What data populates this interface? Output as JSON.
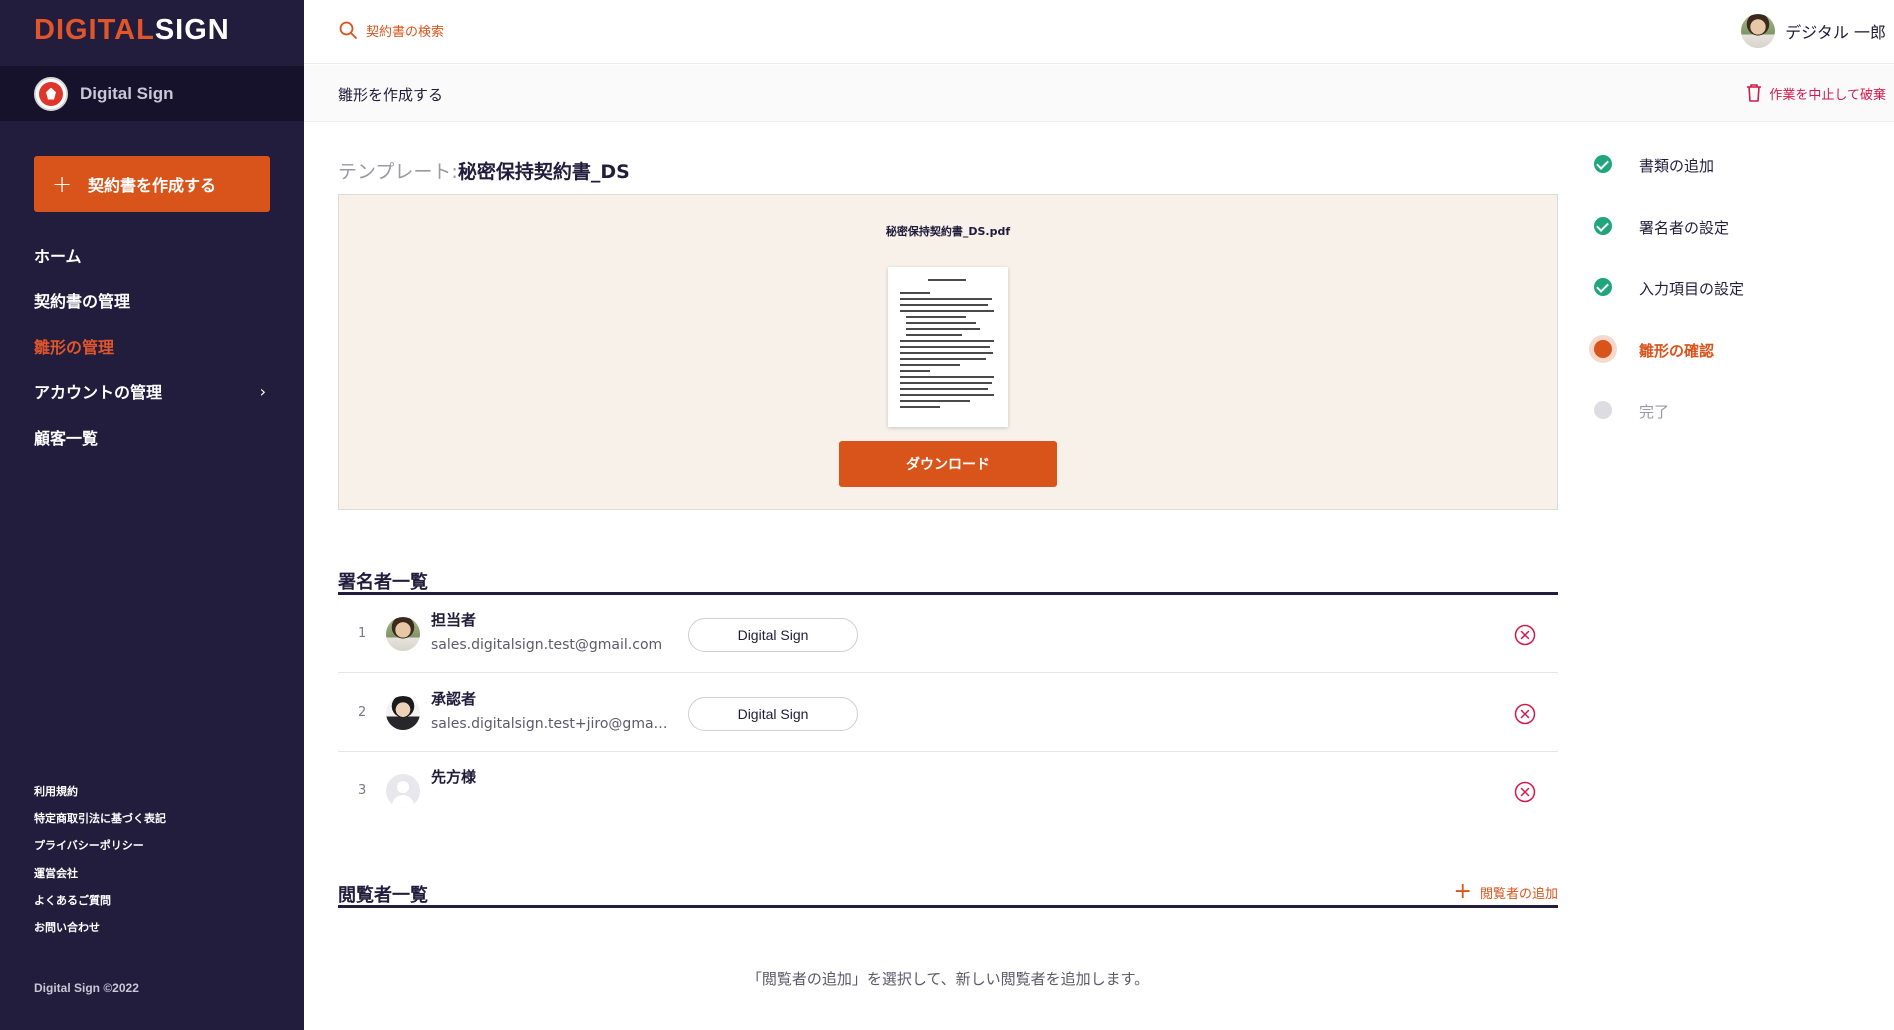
{
  "brand": {
    "logo_part1": "DIGITAL",
    "logo_part2": "SIGN",
    "org_name": "Digital Sign",
    "copyright": "Digital Sign ©2022"
  },
  "sidebar": {
    "create_label": "契約書を作成する",
    "items": [
      {
        "label": "ホーム"
      },
      {
        "label": "契約書の管理"
      },
      {
        "label": "雛形の管理"
      },
      {
        "label": "アカウントの管理",
        "chevron": "›"
      },
      {
        "label": "顧客一覧"
      }
    ],
    "footer_links": [
      "利用規約",
      "特定商取引法に基づく表記",
      "プライバシーポリシー",
      "運営会社",
      "よくあるご質問",
      "お問い合わせ"
    ]
  },
  "header": {
    "search_placeholder": "契約書の検索",
    "user_name": "デジタル 一郎"
  },
  "subheader": {
    "title": "雛形を作成する",
    "discard_label": "作業を中止して破棄"
  },
  "template": {
    "label": "テンプレート:",
    "name": "秘密保持契約書_DS",
    "file_name": "秘密保持契約書_DS.pdf",
    "download_label": "ダウンロード"
  },
  "signers": {
    "title": "署名者一覧",
    "rows": [
      {
        "num": "1",
        "role": "担当者",
        "email": "sales.digitalsign.test@gmail.com",
        "org": "Digital Sign",
        "avatar": "male1"
      },
      {
        "num": "2",
        "role": "承認者",
        "email": "sales.digitalsign.test+jiro@gmail.com",
        "org": "Digital Sign",
        "avatar": "male2"
      },
      {
        "num": "3",
        "role": "先方様",
        "email": "",
        "org": "",
        "avatar": "empty"
      }
    ]
  },
  "viewers": {
    "title": "閲覧者一覧",
    "add_label": "閲覧者の追加",
    "empty_message": "「閲覧者の追加」を選択して、新しい閲覧者を追加します。"
  },
  "stepper": {
    "steps": [
      {
        "label": "書類の追加",
        "status": "done"
      },
      {
        "label": "署名者の設定",
        "status": "done"
      },
      {
        "label": "入力項目の設定",
        "status": "done"
      },
      {
        "label": "雛形の確認",
        "status": "current"
      },
      {
        "label": "完了",
        "status": "todo"
      }
    ]
  },
  "colors": {
    "sidebar_bg": "#221d3d",
    "accent": "#d9541b",
    "success": "#1fa67c",
    "danger": "#d1194b",
    "preview_bg": "#f7f1e9"
  }
}
